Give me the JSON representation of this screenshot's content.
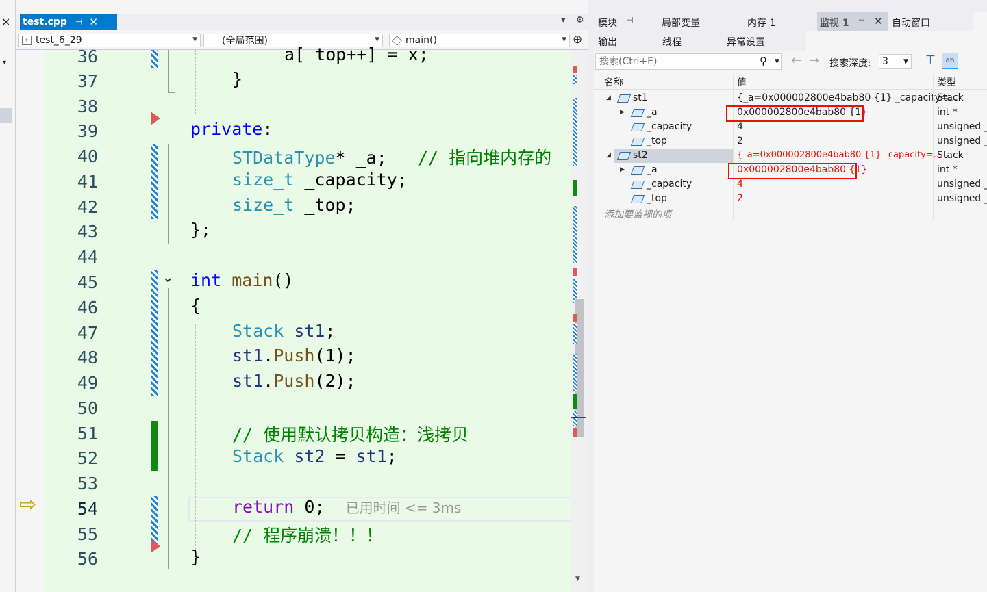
{
  "left_strip": {
    "close_glyph": "×",
    "dropdown_glyph": "▾"
  },
  "editor": {
    "tab": {
      "label": "test.cpp",
      "pin": "⊣",
      "close": "✕"
    },
    "tab_controls": {
      "dropdown": "▾",
      "settings": "⚙"
    },
    "nav": {
      "project": "test_6_29",
      "scope": "(全局范围)",
      "function": "main()",
      "split_glyph": "⊕"
    },
    "lines": [
      {
        "num": "36"
      },
      {
        "num": "37"
      },
      {
        "num": "38"
      },
      {
        "num": "39"
      },
      {
        "num": "40"
      },
      {
        "num": "41"
      },
      {
        "num": "42"
      },
      {
        "num": "43"
      },
      {
        "num": "44"
      },
      {
        "num": "45"
      },
      {
        "num": "46"
      },
      {
        "num": "47"
      },
      {
        "num": "48"
      },
      {
        "num": "49"
      },
      {
        "num": "50"
      },
      {
        "num": "51"
      },
      {
        "num": "52"
      },
      {
        "num": "53"
      },
      {
        "num": "54"
      },
      {
        "num": "55"
      },
      {
        "num": "56"
      }
    ],
    "code": {
      "l36": "_a[_top++] = x;",
      "l37": "}",
      "l39_kw": "private",
      "l39_p": ":",
      "l40_ty": "STDataType",
      "l40_rest": "* _a;   ",
      "l40_cm": "// 指向堆内存的",
      "l41_ty": "size_t",
      "l41_rest": " _capacity;",
      "l42_ty": "size_t",
      "l42_rest": " _top;",
      "l43": "};",
      "l45_kw": "int",
      "l45_fn": "main",
      "l45_rest": "()",
      "l46": "{",
      "l47_ty": "Stack",
      "l47_var": "st1",
      "l47_rest": ";",
      "l48_var": "st1",
      "l48_dot": ".",
      "l48_fn": "Push",
      "l48_rest": "(1);",
      "l49_var": "st1",
      "l49_dot": ".",
      "l49_fn": "Push",
      "l49_rest": "(2);",
      "l51_cm": "// 使用默认拷贝构造：浅拷贝",
      "l52_ty": "Stack",
      "l52_var": "st2",
      "l52_eq": " = ",
      "l52_var2": "st1",
      "l52_rest": ";",
      "l54_kw": "return",
      "l54_rest": " 0;",
      "l54_hint": "已用时间 <= 3ms",
      "l55_cm": "// 程序崩溃！！！",
      "l56": "}"
    },
    "fold_glyph": "⌄",
    "arrow_glyph": "⇨"
  },
  "watch": {
    "tabs_row1": [
      "模块",
      "局部变量",
      "内存 1",
      "监视 1",
      "自动窗口"
    ],
    "tabs_row2": [
      "输出",
      "线程",
      "异常设置"
    ],
    "pin_glyph": "⊣",
    "close_glyph": "✕",
    "search_placeholder": "搜索(Ctrl+E)",
    "search_depth_label": "搜索深度:",
    "search_depth_value": "3",
    "columns": {
      "name": "名称",
      "value": "值",
      "type": "类型"
    },
    "rows": [
      {
        "name": "st1",
        "value": "{_a=0x000002800e4bab80 {1} _capacity=...",
        "type": "Stack",
        "level": 0,
        "expanded": true,
        "changed": false
      },
      {
        "name": "_a",
        "value": "0x000002800e4bab80 {1}",
        "type": "int *",
        "level": 1,
        "expandable": true,
        "changed": false
      },
      {
        "name": "_capacity",
        "value": "4",
        "type": "unsigned _",
        "level": 1,
        "changed": false
      },
      {
        "name": "_top",
        "value": "2",
        "type": "unsigned _",
        "level": 1,
        "changed": false
      },
      {
        "name": "st2",
        "value": "{_a=0x000002800e4bab80 {1} _capacity=...",
        "type": "Stack",
        "level": 0,
        "expanded": true,
        "changed": true
      },
      {
        "name": "_a",
        "value": "0x000002800e4bab80 {1}",
        "type": "int *",
        "level": 1,
        "expandable": true,
        "changed": true
      },
      {
        "name": "_capacity",
        "value": "4",
        "type": "unsigned _",
        "level": 1,
        "changed": true
      },
      {
        "name": "_top",
        "value": "2",
        "type": "unsigned _",
        "level": 1,
        "changed": true
      }
    ],
    "add_item": "添加要监视的项"
  },
  "colors": {
    "accent": "#007acc",
    "changed": "#e51400",
    "code_bg": "#e9fbe7"
  }
}
